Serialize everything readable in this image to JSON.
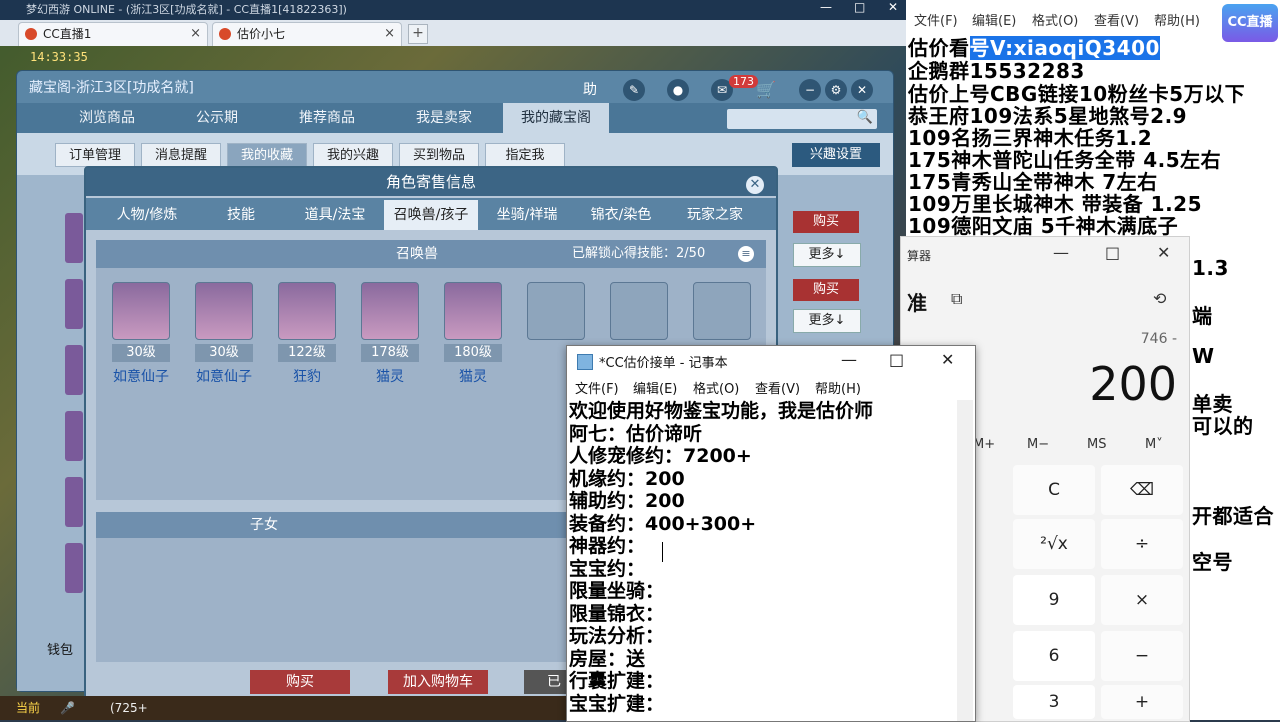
{
  "browser": {
    "title": "梦幻西游 ONLINE - (浙江3区[功成名就] - CC直播1[41822363])",
    "tabs": [
      {
        "label": "CC直播1"
      },
      {
        "label": "估价小七"
      }
    ],
    "tab_plus": "+"
  },
  "treasure": {
    "title": "藏宝阁-浙江3区[功成名就]",
    "help": "助",
    "badge": "173",
    "main_tabs": [
      {
        "label": "浏览商品"
      },
      {
        "label": "公示期"
      },
      {
        "label": "推荐商品"
      },
      {
        "label": "我是卖家"
      },
      {
        "label": "我的藏宝阁"
      }
    ],
    "sub_tabs": [
      {
        "label": "订单管理"
      },
      {
        "label": "消息提醒"
      },
      {
        "label": "我的收藏"
      },
      {
        "label": "我的兴趣"
      },
      {
        "label": "买到物品"
      },
      {
        "label": "指定我"
      }
    ],
    "interest_settings": "兴趣设置",
    "side_buttons": [
      {
        "buy": "购买",
        "more": "更多↓"
      },
      {
        "buy": "购买",
        "more": "更多↓"
      }
    ],
    "wallet": "钱包",
    "game_time": "14:33:35"
  },
  "dialog": {
    "title": "角色寄售信息",
    "tabs": [
      {
        "label": "人物/修炼"
      },
      {
        "label": "技能"
      },
      {
        "label": "道具/法宝"
      },
      {
        "label": "召唤兽/孩子"
      },
      {
        "label": "坐骑/祥瑞"
      },
      {
        "label": "锦衣/染色"
      },
      {
        "label": "玩家之家"
      }
    ],
    "pets_title": "召唤兽",
    "unlock_label": "已解锁心得技能：",
    "unlock_value": "2/50",
    "pets": [
      {
        "level": "30级",
        "name": "如意仙子"
      },
      {
        "level": "30级",
        "name": "如意仙子"
      },
      {
        "level": "122级",
        "name": "狂豹"
      },
      {
        "level": "178级",
        "name": "猫灵"
      },
      {
        "level": "180级",
        "name": "猫灵"
      },
      {
        "level": "",
        "name": ""
      },
      {
        "level": "",
        "name": ""
      },
      {
        "level": "",
        "name": ""
      }
    ],
    "children_title": "子女",
    "buttons": {
      "buy": "购买",
      "add_cart": "加入购物车",
      "third": "已"
    }
  },
  "gamebar": {
    "left": "当前",
    "level_text": "(725+"
  },
  "bg_notepad": {
    "menu": [
      {
        "label": "文件(F)"
      },
      {
        "label": "编辑(E)"
      },
      {
        "label": "格式(O)"
      },
      {
        "label": "查看(V)"
      },
      {
        "label": "帮助(H)"
      }
    ],
    "lines": [
      {
        "pre": "估价看",
        "hl": "号V:xiaoqiQ3400"
      },
      {
        "pre": "企鹅群15532283",
        "hl": ""
      },
      {
        "pre": "估价上号CBG链接10粉丝卡5万以下",
        "hl": ""
      },
      {
        "pre": "恭王府109法系5星地煞号2.9",
        "hl": ""
      },
      {
        "pre": "109名扬三界神木任务1.2",
        "hl": ""
      },
      {
        "pre": "175神木普陀山任务全带 4.5左右",
        "hl": ""
      },
      {
        "pre": "175青秀山全带神木  7左右",
        "hl": ""
      },
      {
        "pre": "109万里长城神木 带装备  1.25",
        "hl": ""
      },
      {
        "pre": "109德阳文庙 5千神木满底子",
        "hl": ""
      }
    ],
    "right_fragments": [
      "1.3",
      "端",
      "W",
      "单卖",
      "可以的",
      "开都适合",
      "空号"
    ],
    "logo": "CC直播"
  },
  "calculator": {
    "title": "算器",
    "mode": "准",
    "expr": "746 -",
    "display": "200",
    "mem": [
      "M+",
      "M−",
      "MS",
      "M˅"
    ],
    "keys": [
      "C",
      "⌫",
      "²√x",
      "÷",
      "9",
      "×",
      "6",
      "−",
      "3",
      "+"
    ]
  },
  "notepad": {
    "title": "*CC估价接单 - 记事本",
    "menu": [
      {
        "label": "文件(F)"
      },
      {
        "label": "编辑(E)"
      },
      {
        "label": "格式(O)"
      },
      {
        "label": "查看(V)"
      },
      {
        "label": "帮助(H)"
      }
    ],
    "lines": [
      "欢迎使用好物鉴宝功能，我是估价师",
      "阿七：估价谛听",
      "人修宠修约：7200+",
      "机缘约：200",
      "辅助约：200",
      "装备约：400+300+",
      "神器约：",
      "宝宝约：",
      "限量坐骑：",
      "限量锦衣：",
      "玩法分析：",
      "房屋：送",
      "行囊扩建：",
      "宝宝扩建："
    ]
  }
}
